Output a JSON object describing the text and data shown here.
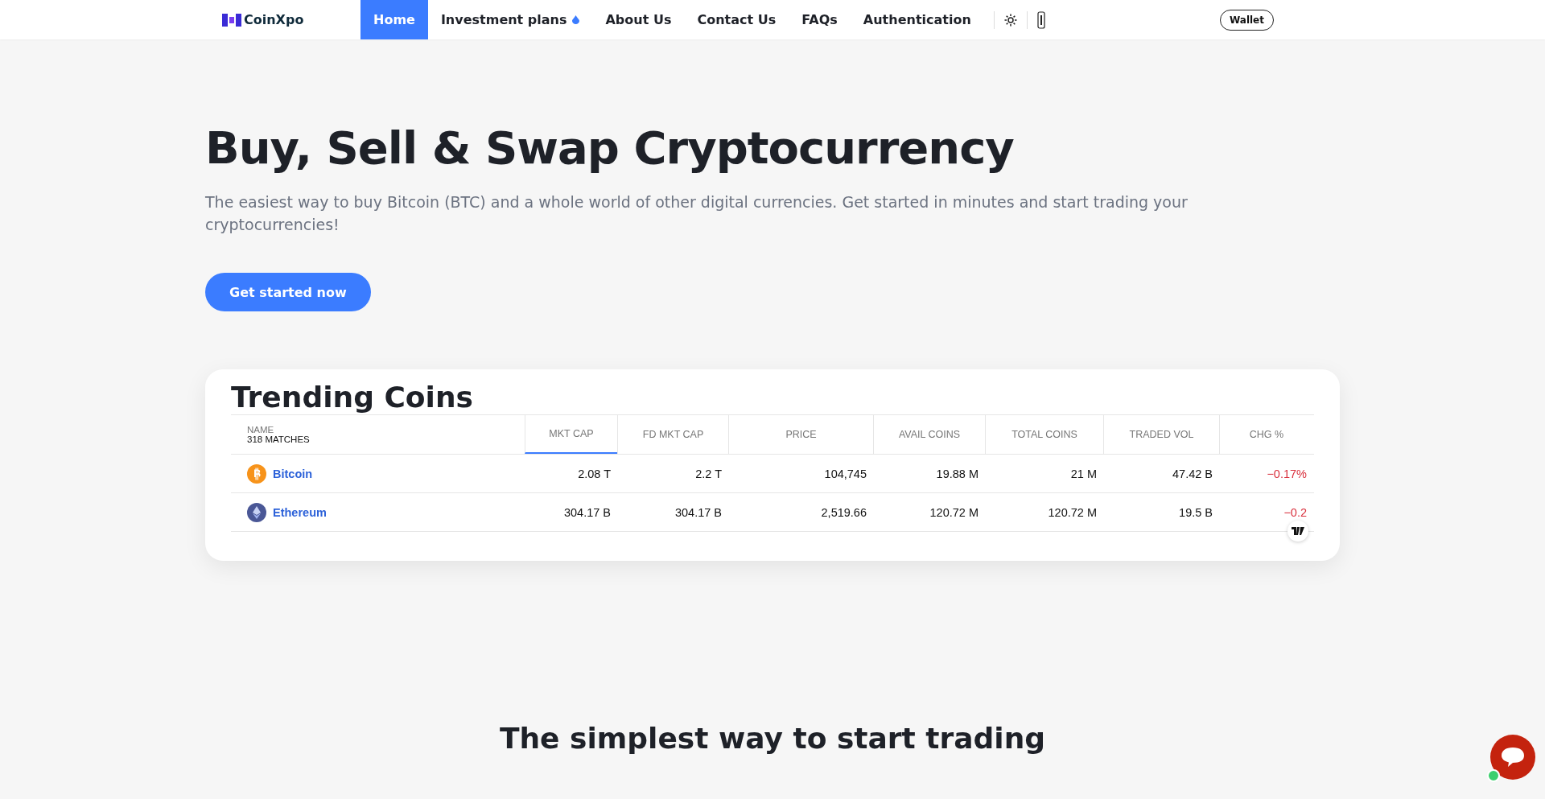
{
  "nav": {
    "logo": "CoinXpo",
    "items": [
      {
        "label": "Home",
        "selected": true,
        "dropdown": false
      },
      {
        "label": "Investment plans",
        "selected": false,
        "dropdown": true
      },
      {
        "label": "About Us",
        "selected": false,
        "dropdown": false
      },
      {
        "label": "Contact Us",
        "selected": false,
        "dropdown": false
      },
      {
        "label": "FAQs",
        "selected": false,
        "dropdown": false
      },
      {
        "label": "Authentication",
        "selected": false,
        "dropdown": false
      }
    ],
    "wallet": "Wallet"
  },
  "hero": {
    "title": "Buy, Sell & Swap Cryptocurrency",
    "subtitle": "The easiest way to buy Bitcoin (BTC) and a whole world of other digital currencies. Get started in minutes and start trading your cryptocurrencies!",
    "button": "Get started now"
  },
  "trending": {
    "title": "Trending Coins",
    "name_header": "NAME",
    "matches": "318 MATCHES",
    "columns": [
      {
        "label": "MKT CAP",
        "selected": true
      },
      {
        "label": "FD MKT CAP",
        "selected": false
      },
      {
        "label": "PRICE",
        "selected": false
      },
      {
        "label": "AVAIL COINS",
        "selected": false
      },
      {
        "label": "TOTAL COINS",
        "selected": false
      },
      {
        "label": "TRADED VOL",
        "selected": false
      },
      {
        "label": "CHG %",
        "selected": false
      }
    ],
    "rows": [
      {
        "name": "Bitcoin",
        "kind": "bitcoin",
        "cells": [
          "2.08 T",
          "2.2 T",
          "104,745",
          "19.88 M",
          "21 M",
          "47.42 B"
        ],
        "change": "−0.17%"
      },
      {
        "name": "Ethereum",
        "kind": "ethereum",
        "cells": [
          "304.17 B",
          "304.17 B",
          "2,519.66",
          "120.72 M",
          "120.72 M",
          "19.5 B"
        ],
        "change": "−0.2"
      }
    ]
  },
  "section_title": "The simplest way to start trading"
}
